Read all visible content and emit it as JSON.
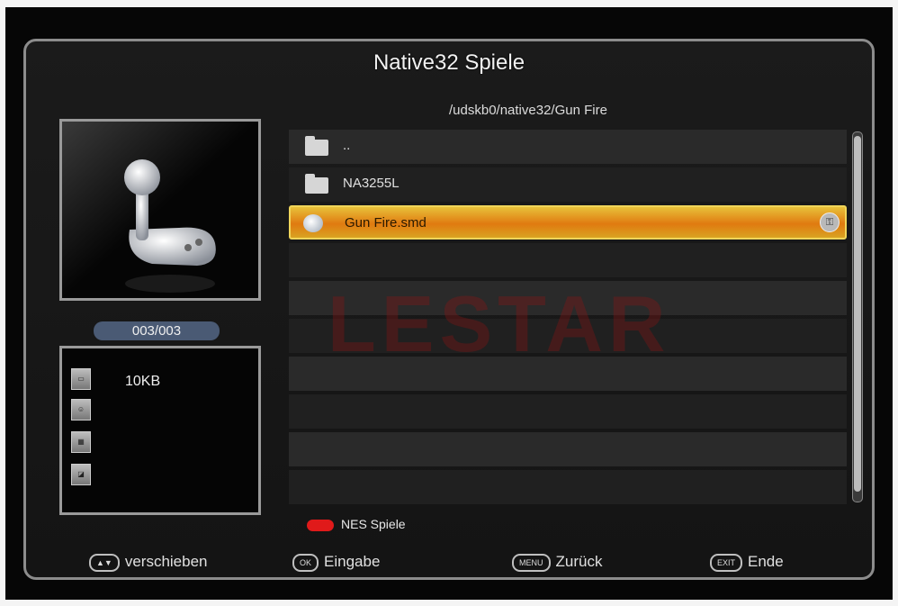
{
  "header": {
    "title": "Native32 Spiele",
    "path": "/udskb0/native32/Gun Fire"
  },
  "left": {
    "counter": "003/003",
    "info": {
      "size": "10KB",
      "icons": [
        "file-size-icon",
        "person-icon",
        "date-icon",
        "type-icon"
      ]
    }
  },
  "list": {
    "items": [
      {
        "label": "..",
        "type": "folder"
      },
      {
        "label": "NA3255L",
        "type": "folder"
      },
      {
        "label": "Gun Fire.smd",
        "type": "file",
        "selected": true
      }
    ]
  },
  "watermark": "LESTAR",
  "red_button": {
    "label": "NES Spiele",
    "color": "#e01a1a"
  },
  "footer": [
    {
      "key": "▲▼",
      "label": "verschieben"
    },
    {
      "key": "OK",
      "label": "Eingabe"
    },
    {
      "key": "MENU",
      "label": "Zurück"
    },
    {
      "key": "EXIT",
      "label": "Ende"
    }
  ],
  "colors": {
    "selection": "#e58a12",
    "accent_counter": "#4a5a74"
  }
}
